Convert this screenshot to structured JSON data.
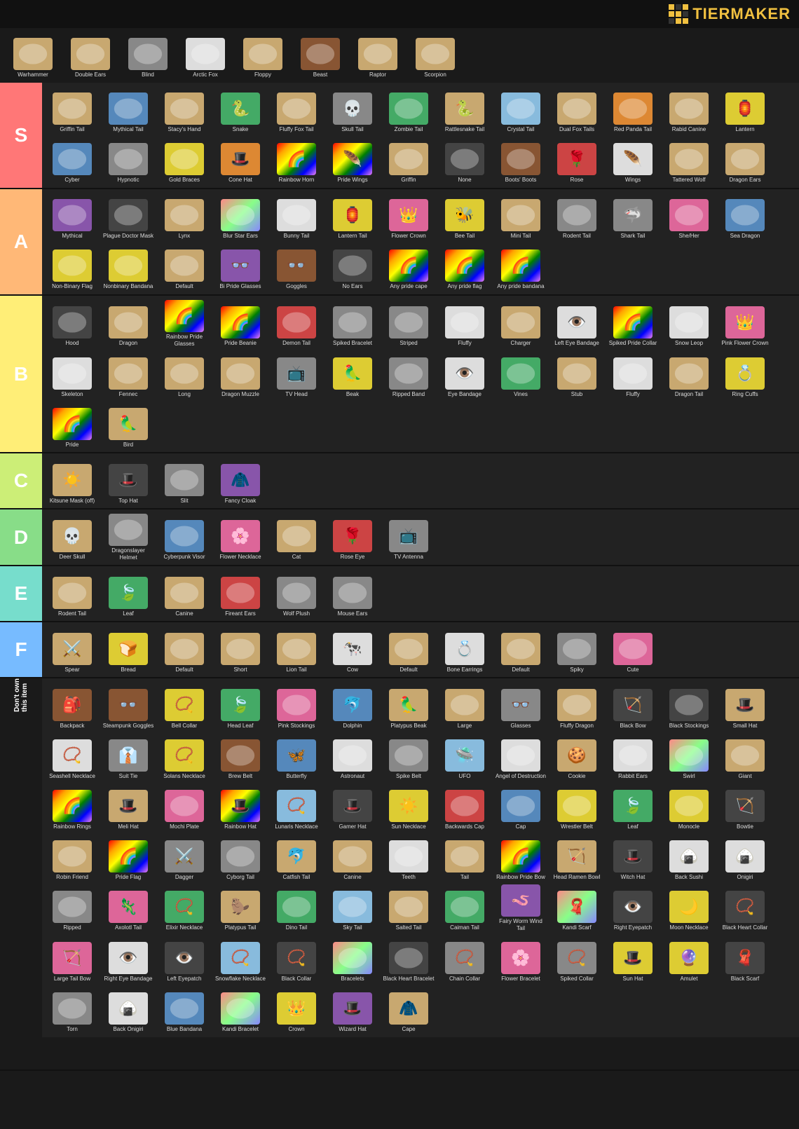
{
  "header": {
    "logo_text": "TiERMAkER",
    "top_items": [
      {
        "label": "Warhammer",
        "color": "bg-tan"
      },
      {
        "label": "Double Ears",
        "color": "bg-tan"
      },
      {
        "label": "Blind",
        "color": "bg-gray"
      },
      {
        "label": "Arctic Fox",
        "color": "bg-white"
      },
      {
        "label": "Floppy",
        "color": "bg-tan"
      },
      {
        "label": "Beast",
        "color": "bg-brown"
      },
      {
        "label": "Raptor",
        "color": "bg-tan"
      },
      {
        "label": "Scorpion",
        "color": "bg-tan"
      }
    ]
  },
  "tiers": [
    {
      "id": "S",
      "color": "tier-s",
      "items": [
        {
          "label": "Griffin Tail",
          "color": "bg-tan"
        },
        {
          "label": "Mythical Tail",
          "color": "bg-blue"
        },
        {
          "label": "Stacy's Hand",
          "color": "bg-tan"
        },
        {
          "label": "Snake",
          "color": "bg-green"
        },
        {
          "label": "Fluffy Fox Tail",
          "color": "bg-tan"
        },
        {
          "label": "Skull Tail",
          "color": "bg-gray"
        },
        {
          "label": "Zombie Tail",
          "color": "bg-green"
        },
        {
          "label": "Rattlesnake Tail",
          "color": "bg-tan"
        },
        {
          "label": "Crystal Tail",
          "color": "bg-lightblue"
        },
        {
          "label": "Dual Fox Tails",
          "color": "bg-tan"
        },
        {
          "label": "Red Panda Tail",
          "color": "bg-orange"
        },
        {
          "label": "Rabid Canine",
          "color": "bg-tan"
        },
        {
          "label": "Lantern",
          "color": "bg-yellow"
        },
        {
          "label": "Cyber",
          "color": "bg-blue"
        },
        {
          "label": "Hypnotic",
          "color": "bg-gray"
        },
        {
          "label": "Gold Braces",
          "color": "bg-yellow"
        },
        {
          "label": "Cone Hat",
          "color": "bg-orange"
        },
        {
          "label": "Rainbow Horn",
          "color": "bg-rainbow"
        },
        {
          "label": "Pride Wings",
          "color": "bg-rainbow"
        },
        {
          "label": "Griffin",
          "color": "bg-tan"
        },
        {
          "label": "None",
          "color": "bg-dark"
        },
        {
          "label": "Boots' Boots",
          "color": "bg-brown"
        },
        {
          "label": "Rose",
          "color": "bg-red"
        },
        {
          "label": "Wings",
          "color": "bg-white"
        },
        {
          "label": "Tattered Wolf",
          "color": "bg-tan"
        },
        {
          "label": "Dragon Ears",
          "color": "bg-tan"
        }
      ]
    },
    {
      "id": "A",
      "color": "tier-a",
      "items": [
        {
          "label": "Mythical",
          "color": "bg-purple"
        },
        {
          "label": "Plague Doctor Mask",
          "color": "bg-dark"
        },
        {
          "label": "Lynx",
          "color": "bg-tan"
        },
        {
          "label": "Blur Star Ears",
          "color": "bg-multicolor"
        },
        {
          "label": "Bunny Tail",
          "color": "bg-white"
        },
        {
          "label": "Lantern Tail",
          "color": "bg-yellow"
        },
        {
          "label": "Flower Crown",
          "color": "bg-pink"
        },
        {
          "label": "Bee Tail",
          "color": "bg-yellow"
        },
        {
          "label": "Mini Tail",
          "color": "bg-tan"
        },
        {
          "label": "Rodent Tail",
          "color": "bg-gray"
        },
        {
          "label": "Shark Tail",
          "color": "bg-gray"
        },
        {
          "label": "She/Her",
          "color": "bg-pink"
        },
        {
          "label": "Sea Dragon",
          "color": "bg-blue"
        },
        {
          "label": "Non-Binary Flag",
          "color": "bg-yellow"
        },
        {
          "label": "Nonbinary Bandana",
          "color": "bg-yellow"
        },
        {
          "label": "Default",
          "color": "bg-tan"
        },
        {
          "label": "Bi Pride Glasses",
          "color": "bg-purple"
        },
        {
          "label": "Goggles",
          "color": "bg-brown"
        },
        {
          "label": "No Ears",
          "color": "bg-dark"
        },
        {
          "label": "Any pride cape",
          "color": "bg-rainbow"
        },
        {
          "label": "Any pride flag",
          "color": "bg-rainbow"
        },
        {
          "label": "Any pride bandana",
          "color": "bg-rainbow"
        }
      ]
    },
    {
      "id": "B",
      "color": "tier-b",
      "items": [
        {
          "label": "Hood",
          "color": "bg-dark"
        },
        {
          "label": "Dragon",
          "color": "bg-tan"
        },
        {
          "label": "Rainbow Pride Glasses",
          "color": "bg-rainbow"
        },
        {
          "label": "Pride Beanie",
          "color": "bg-rainbow"
        },
        {
          "label": "Demon Tail",
          "color": "bg-red"
        },
        {
          "label": "Spiked Bracelet",
          "color": "bg-gray"
        },
        {
          "label": "Striped",
          "color": "bg-gray"
        },
        {
          "label": "Fluffy",
          "color": "bg-white"
        },
        {
          "label": "Charger",
          "color": "bg-tan"
        },
        {
          "label": "Left Eye Bandage",
          "color": "bg-white"
        },
        {
          "label": "Spiked Pride Collar",
          "color": "bg-rainbow"
        },
        {
          "label": "Snow Leop",
          "color": "bg-white"
        },
        {
          "label": "Pink Flower Crown",
          "color": "bg-pink"
        },
        {
          "label": "Skeleton",
          "color": "bg-white"
        },
        {
          "label": "Fennec",
          "color": "bg-tan"
        },
        {
          "label": "Long",
          "color": "bg-tan"
        },
        {
          "label": "Dragon Muzzle",
          "color": "bg-tan"
        },
        {
          "label": "TV Head",
          "color": "bg-gray"
        },
        {
          "label": "Beak",
          "color": "bg-yellow"
        },
        {
          "label": "Ripped Band",
          "color": "bg-gray"
        },
        {
          "label": "Eye Bandage",
          "color": "bg-white"
        },
        {
          "label": "Vines",
          "color": "bg-green"
        },
        {
          "label": "Stub",
          "color": "bg-tan"
        },
        {
          "label": "Fluffy",
          "color": "bg-white"
        },
        {
          "label": "Dragon Tail",
          "color": "bg-tan"
        },
        {
          "label": "Ring Cuffs",
          "color": "bg-yellow"
        },
        {
          "label": "Pride",
          "color": "bg-rainbow"
        },
        {
          "label": "Bird",
          "color": "bg-tan"
        }
      ]
    },
    {
      "id": "C",
      "color": "tier-c",
      "items": [
        {
          "label": "Kitsune Mask (off)",
          "color": "bg-tan"
        },
        {
          "label": "Top Hat",
          "color": "bg-dark"
        },
        {
          "label": "Slit",
          "color": "bg-gray"
        },
        {
          "label": "Fancy Cloak",
          "color": "bg-purple"
        }
      ]
    },
    {
      "id": "D",
      "color": "tier-d",
      "items": [
        {
          "label": "Deer Skull",
          "color": "bg-tan"
        },
        {
          "label": "Dragonslayer Helmet",
          "color": "bg-gray"
        },
        {
          "label": "Cyberpunk Visor",
          "color": "bg-blue"
        },
        {
          "label": "Flower Necklace",
          "color": "bg-pink"
        },
        {
          "label": "Cat",
          "color": "bg-tan"
        },
        {
          "label": "Rose Eye",
          "color": "bg-red"
        },
        {
          "label": "TV Antenna",
          "color": "bg-gray"
        }
      ]
    },
    {
      "id": "E",
      "color": "tier-e",
      "items": [
        {
          "label": "Rodent Tail",
          "color": "bg-tan"
        },
        {
          "label": "Leaf",
          "color": "bg-green"
        },
        {
          "label": "Canine",
          "color": "bg-tan"
        },
        {
          "label": "Fireant Ears",
          "color": "bg-red"
        },
        {
          "label": "Wolf Plush",
          "color": "bg-gray"
        },
        {
          "label": "Mouse Ears",
          "color": "bg-gray"
        }
      ]
    },
    {
      "id": "F",
      "color": "tier-f",
      "items": [
        {
          "label": "Spear",
          "color": "bg-tan"
        },
        {
          "label": "Bread",
          "color": "bg-yellow"
        },
        {
          "label": "Default",
          "color": "bg-tan"
        },
        {
          "label": "Short",
          "color": "bg-tan"
        },
        {
          "label": "Lion Tail",
          "color": "bg-tan"
        },
        {
          "label": "Cow",
          "color": "bg-white"
        },
        {
          "label": "Default",
          "color": "bg-tan"
        },
        {
          "label": "Bone Earrings",
          "color": "bg-white"
        },
        {
          "label": "Default",
          "color": "bg-tan"
        },
        {
          "label": "Spiky",
          "color": "bg-gray"
        },
        {
          "label": "Cute",
          "color": "bg-pink"
        }
      ]
    }
  ],
  "dont_own": {
    "label": "Don't own\nthis item",
    "rows": [
      [
        {
          "label": "Backpack",
          "color": "bg-brown"
        },
        {
          "label": "Steampunk Goggles",
          "color": "bg-brown"
        },
        {
          "label": "Bell Collar",
          "color": "bg-yellow"
        },
        {
          "label": "Head Leaf",
          "color": "bg-green"
        },
        {
          "label": "Pink Stockings",
          "color": "bg-pink"
        },
        {
          "label": "Dolphin",
          "color": "bg-blue"
        },
        {
          "label": "Platypus Beak",
          "color": "bg-tan"
        },
        {
          "label": "Large",
          "color": "bg-tan"
        },
        {
          "label": "Glasses",
          "color": "bg-gray"
        },
        {
          "label": "Fluffy Dragon",
          "color": "bg-tan"
        },
        {
          "label": "Black Bow",
          "color": "bg-dark"
        },
        {
          "label": "Black Stockings",
          "color": "bg-dark"
        }
      ],
      [
        {
          "label": "Small Hat",
          "color": "bg-tan"
        },
        {
          "label": "Seashell Necklace",
          "color": "bg-white"
        },
        {
          "label": "Suit Tie",
          "color": "bg-gray"
        },
        {
          "label": "Solans Necklace",
          "color": "bg-yellow"
        },
        {
          "label": "Brew Belt",
          "color": "bg-brown"
        },
        {
          "label": "Butterfly",
          "color": "bg-blue"
        },
        {
          "label": "Astronaut",
          "color": "bg-white"
        },
        {
          "label": "Spike Belt",
          "color": "bg-gray"
        },
        {
          "label": "UFO",
          "color": "bg-lightblue"
        },
        {
          "label": "Angel of Destruction",
          "color": "bg-white"
        },
        {
          "label": "Cookie",
          "color": "bg-tan"
        },
        {
          "label": "Rabbit Ears",
          "color": "bg-white"
        }
      ],
      [
        {
          "label": "Swirl",
          "color": "bg-multicolor"
        },
        {
          "label": "Giant",
          "color": "bg-tan"
        },
        {
          "label": "Rainbow Rings",
          "color": "bg-rainbow"
        },
        {
          "label": "Meli Hat",
          "color": "bg-tan"
        },
        {
          "label": "Mochi Plate",
          "color": "bg-pink"
        },
        {
          "label": "Rainbow Hat",
          "color": "bg-rainbow"
        },
        {
          "label": "Lunaris Necklace",
          "color": "bg-lightblue"
        },
        {
          "label": "Gamer Hat",
          "color": "bg-dark"
        },
        {
          "label": "Sun Necklace",
          "color": "bg-yellow"
        },
        {
          "label": "Backwards Cap",
          "color": "bg-red"
        },
        {
          "label": "Cap",
          "color": "bg-blue"
        },
        {
          "label": "Wrestler Belt",
          "color": "bg-yellow"
        }
      ],
      [
        {
          "label": "Leaf",
          "color": "bg-green"
        },
        {
          "label": "Monocle",
          "color": "bg-yellow"
        },
        {
          "label": "Bowtie",
          "color": "bg-dark"
        },
        {
          "label": "Robin Friend",
          "color": "bg-tan"
        },
        {
          "label": "Pride Flag",
          "color": "bg-rainbow"
        },
        {
          "label": "Dagger",
          "color": "bg-gray"
        },
        {
          "label": "Cyborg Tail",
          "color": "bg-gray"
        },
        {
          "label": "Catfish Tail",
          "color": "bg-tan"
        },
        {
          "label": "Canine",
          "color": "bg-tan"
        },
        {
          "label": "Teeth",
          "color": "bg-white"
        },
        {
          "label": "Tail",
          "color": "bg-tan"
        },
        {
          "label": "Rainbow Pride Bow",
          "color": "bg-rainbow"
        },
        {
          "label": "Head Ramen Bowl",
          "color": "bg-tan"
        }
      ],
      [
        {
          "label": "Witch Hat",
          "color": "bg-dark"
        },
        {
          "label": "Back Sushi",
          "color": "bg-white"
        },
        {
          "label": "Onigiri",
          "color": "bg-white"
        },
        {
          "label": "Ripped",
          "color": "bg-gray"
        },
        {
          "label": "Axolotl Tail",
          "color": "bg-pink"
        },
        {
          "label": "Elixir Necklace",
          "color": "bg-green"
        },
        {
          "label": "Platypus Tail",
          "color": "bg-tan"
        },
        {
          "label": "Dino Tail",
          "color": "bg-green"
        },
        {
          "label": "Sky Tail",
          "color": "bg-lightblue"
        },
        {
          "label": "Salted Tail",
          "color": "bg-tan"
        },
        {
          "label": "Caiman Tail",
          "color": "bg-green"
        },
        {
          "label": "Fairy Worm Wind Tail",
          "color": "bg-purple"
        }
      ],
      [
        {
          "label": "Kandi Scarf",
          "color": "bg-multicolor"
        },
        {
          "label": "Right Eyepatch",
          "color": "bg-dark"
        },
        {
          "label": "Moon Necklace",
          "color": "bg-yellow"
        },
        {
          "label": "Black Heart Collar",
          "color": "bg-dark"
        },
        {
          "label": "Large Tail Bow",
          "color": "bg-pink"
        },
        {
          "label": "Right Eye Bandage",
          "color": "bg-white"
        },
        {
          "label": "Left Eyepatch",
          "color": "bg-dark"
        },
        {
          "label": "Snowflake Necklace",
          "color": "bg-lightblue"
        },
        {
          "label": "Black Collar",
          "color": "bg-dark"
        },
        {
          "label": "Bracelets",
          "color": "bg-multicolor"
        },
        {
          "label": "Black Heart Bracelet",
          "color": "bg-dark"
        },
        {
          "label": "Chain Collar",
          "color": "bg-gray"
        }
      ],
      [
        {
          "label": "Flower Bracelet",
          "color": "bg-pink"
        },
        {
          "label": "Spiked Collar",
          "color": "bg-gray"
        },
        {
          "label": "Sun Hat",
          "color": "bg-yellow"
        },
        {
          "label": "Amulet",
          "color": "bg-yellow"
        },
        {
          "label": "Black Scarf",
          "color": "bg-dark"
        },
        {
          "label": "Torn",
          "color": "bg-gray"
        },
        {
          "label": "Back Onigiri",
          "color": "bg-white"
        },
        {
          "label": "Blue Bandana",
          "color": "bg-blue"
        },
        {
          "label": "Kandi Bracelet",
          "color": "bg-multicolor"
        },
        {
          "label": "Crown",
          "color": "bg-yellow"
        },
        {
          "label": "Wizard Hat",
          "color": "bg-purple"
        },
        {
          "label": "Cape",
          "color": "bg-tan"
        }
      ]
    ]
  }
}
